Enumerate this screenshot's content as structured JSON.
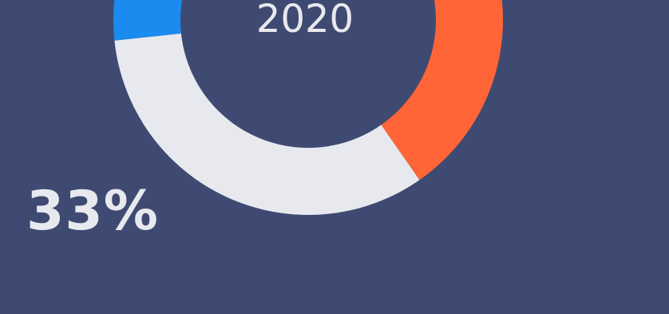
{
  "chart_data": {
    "type": "pie",
    "title": "2020",
    "slices": [
      {
        "label": "",
        "value": 40,
        "color": "#ff6536"
      },
      {
        "label": "33%",
        "value": 33,
        "color": "#e8e9ef"
      },
      {
        "label": "",
        "value": 27,
        "color": "#1c8bf0"
      }
    ],
    "start_color_background": "#3f4a72"
  }
}
